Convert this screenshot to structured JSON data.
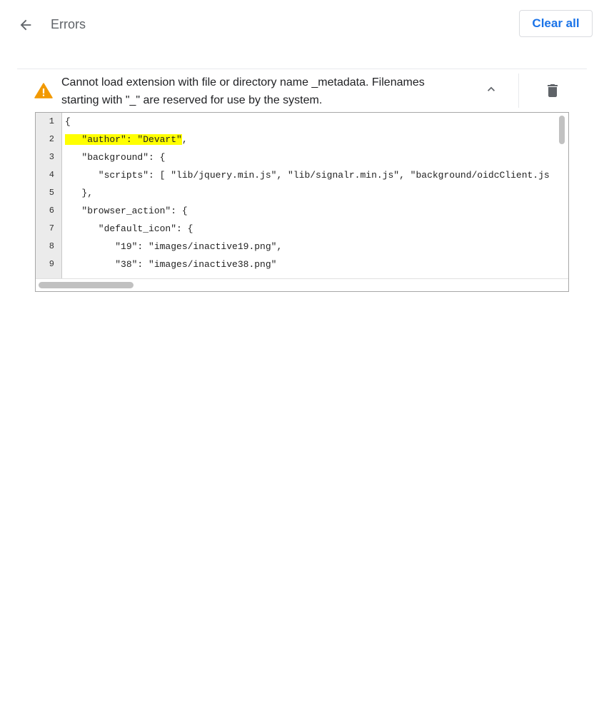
{
  "header": {
    "title": "Errors",
    "clear_all_label": "Clear all"
  },
  "error": {
    "message": "Cannot load extension with file or directory name _metadata. Filenames starting with \"_\" are reserved for use by the system.",
    "severity_icon": "warning-icon",
    "colors": {
      "warning": "#f29900",
      "highlight": "#ffff00",
      "accent": "#1a73e8"
    }
  },
  "code": {
    "line_numbers": [
      "1",
      "2",
      "3",
      "4",
      "5",
      "6",
      "7",
      "8",
      "9"
    ],
    "lines": [
      "{",
      "   \"author\": \"Devart\",",
      "   \"background\": {",
      "      \"scripts\": [ \"lib/jquery.min.js\", \"lib/signalr.min.js\", \"background/oidcClient.js",
      "   },",
      "   \"browser_action\": {",
      "      \"default_icon\": {",
      "         \"19\": \"images/inactive19.png\",",
      "         \"38\": \"images/inactive38.png\""
    ],
    "highlighted_line": "2",
    "highlighted_text": "   \"author\": \"Devart\""
  }
}
